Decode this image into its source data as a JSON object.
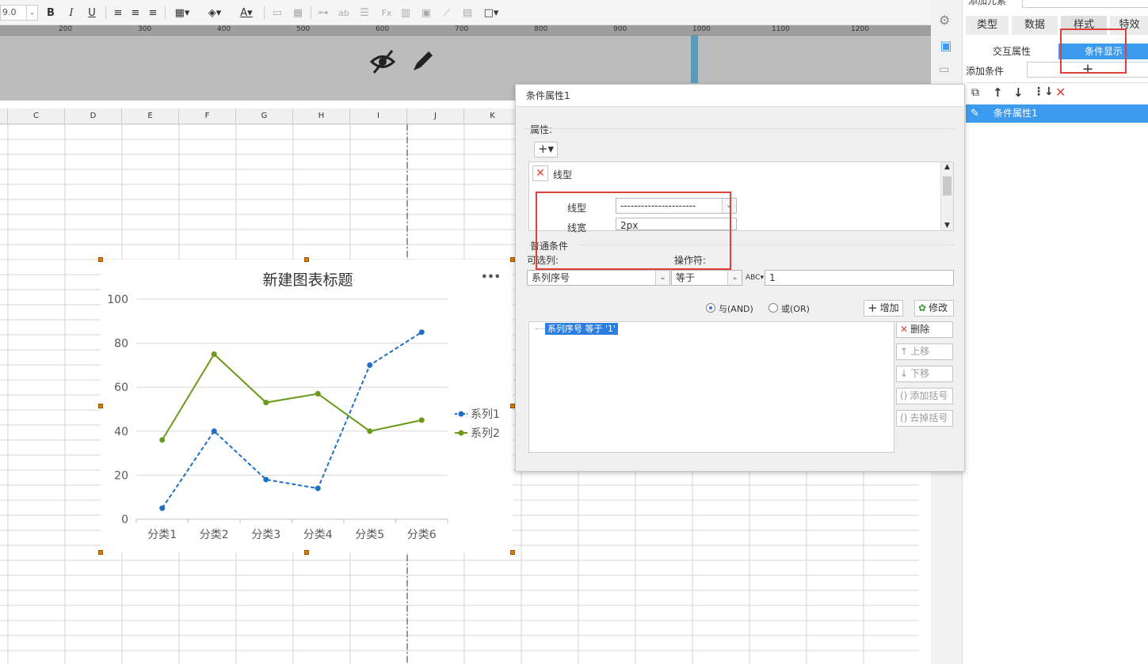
{
  "toolbar": {
    "font_size": "9.0",
    "bold": "B",
    "italic": "I",
    "underline": "U"
  },
  "ruler": {
    "ticks": [
      "200",
      "300",
      "400",
      "500",
      "600",
      "700",
      "800",
      "900",
      "1000",
      "1100",
      "1200"
    ]
  },
  "grid": {
    "columns": [
      "C",
      "D",
      "E",
      "F",
      "G",
      "H",
      "I",
      "J",
      "K"
    ]
  },
  "chart_data": {
    "type": "line",
    "title": "新建图表标题",
    "categories": [
      "分类1",
      "分类2",
      "分类3",
      "分类4",
      "分类5",
      "分类6"
    ],
    "series": [
      {
        "name": "系列1",
        "values": [
          5,
          40,
          18,
          14,
          70,
          85
        ],
        "color": "#1f6fc6",
        "dash": true
      },
      {
        "name": "系列2",
        "values": [
          36,
          75,
          53,
          57,
          40,
          45
        ],
        "color": "#6a9a1a",
        "dash": false
      }
    ],
    "ylim": [
      0,
      100
    ],
    "yticks": [
      "0",
      "20",
      "40",
      "60",
      "80",
      "100"
    ],
    "legend": "right",
    "menu": "•••"
  },
  "right_panel": {
    "header": "添加元素",
    "tabs": [
      "类型",
      "数据",
      "样式",
      "特效"
    ],
    "sub_tabs": [
      "交互属性",
      "条件显示"
    ],
    "add_condition_label": "添加条件",
    "add_condition_plus": "+",
    "list_items": [
      "条件属性1"
    ]
  },
  "dialog": {
    "title": "条件属性1",
    "attr_section": "属性:",
    "attr_item": "线型",
    "line_type_label": "线型",
    "line_type_value": "----------------------",
    "line_width_label": "线宽",
    "line_width_value": "2px",
    "normal_condition": "普通条件",
    "column_label": "可选列:",
    "operator_label": "操作符:",
    "column_value": "系列序号",
    "operator_value": "等于",
    "value_value": "1",
    "and_label": "与(AND)",
    "or_label": "或(OR)",
    "add_btn": "增加",
    "modify_btn": "修改",
    "condition_item": "系列序号 等于 '1'",
    "delete_btn": "删除",
    "up_btn": "上移",
    "down_btn": "下移",
    "add_bracket_btn": "添加括号",
    "remove_bracket_btn": "去掉括号"
  },
  "colors": {
    "accent": "#3c9bef",
    "highlight": "#2b7de0",
    "red_box": "#e0403a"
  }
}
